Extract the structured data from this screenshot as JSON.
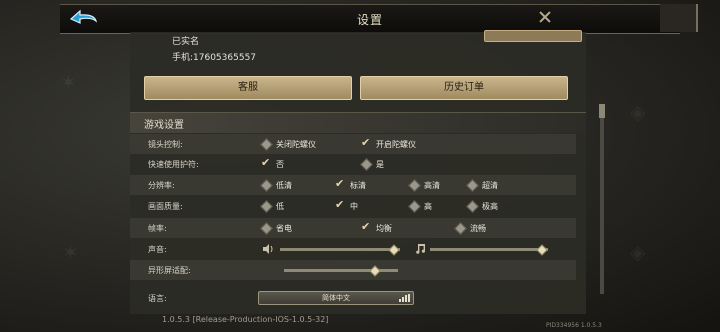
{
  "header": {
    "title": "设置",
    "back_icon": "back-arrow-icon",
    "close_icon": "close-icon"
  },
  "account": {
    "name_status": "已实名",
    "phone": "手机:17605365557",
    "buttons": {
      "service": "客服",
      "history": "历史订单"
    }
  },
  "game_settings": {
    "section_title": "游戏设置",
    "rows": {
      "camera": {
        "label": "镜头控制:",
        "options": [
          "关闭陀螺仪",
          "开启陀螺仪"
        ],
        "selected": "开启陀螺仪"
      },
      "quick_use": {
        "label": "快速使用护符:",
        "options": [
          "否",
          "是"
        ],
        "selected": "否"
      },
      "resolution": {
        "label": "分辨率:",
        "options": [
          "低清",
          "标清",
          "高清",
          "超清"
        ],
        "selected": "标清"
      },
      "quality": {
        "label": "画面质量:",
        "options": [
          "低",
          "中",
          "高",
          "极高"
        ],
        "selected": "中"
      },
      "framerate": {
        "label": "帧率:",
        "options": [
          "省电",
          "均衡",
          "流畅"
        ],
        "selected": "均衡"
      },
      "sound": {
        "label": "声音:",
        "sfx_level": 0.95,
        "music_level": 0.95
      },
      "notch": {
        "label": "异形屏适配:",
        "level": 0.8
      },
      "language": {
        "label": "语言:",
        "value": "简体中文"
      }
    }
  },
  "footer": {
    "version": "1.0.5.3 [Release-Production-IOS-1.0.5-32]",
    "build_id": "PID334956 1.0.5.3"
  },
  "colors": {
    "panel": "#2c2c26",
    "accent": "#c9b58c",
    "text": "#e6e2d6"
  }
}
